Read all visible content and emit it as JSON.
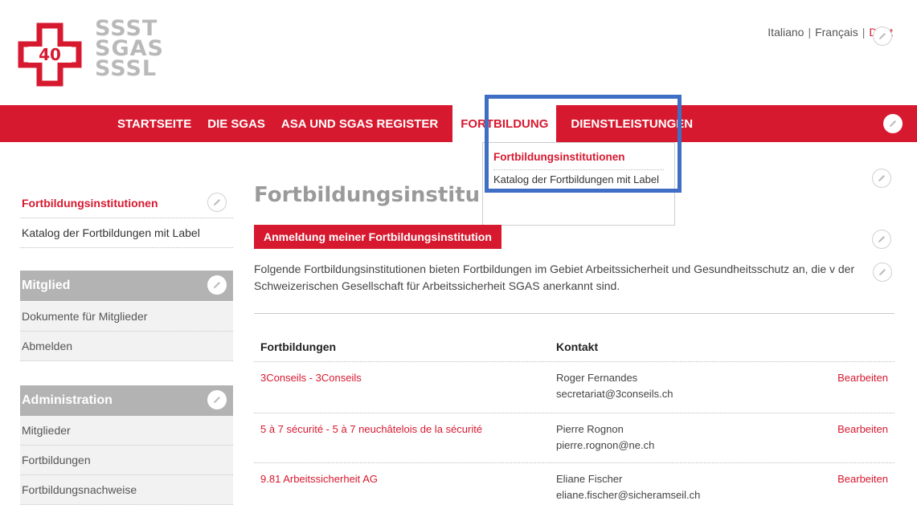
{
  "brand": {
    "logo_number": "40",
    "logo_lines": [
      "SSST",
      "SGAS",
      "SSSL"
    ],
    "accent": "#d7192f",
    "highlight": "#3f6fc4"
  },
  "languages": [
    {
      "label": "Italiano",
      "active": false
    },
    {
      "label": "Français",
      "active": false
    },
    {
      "label": "Deut",
      "active": true
    }
  ],
  "nav": {
    "items": [
      "STARTSEITE",
      "DIE SGAS",
      "ASA UND SGAS REGISTER",
      "FORTBILDUNG",
      "DIENSTLEISTUNGEN"
    ],
    "active": "FORTBILDUNG"
  },
  "dropdown": {
    "item1": "Fortbildungsinstitutionen",
    "item2": "Katalog der Fortbildungen mit Label"
  },
  "sidebar": {
    "links": [
      "Fortbildungsinstitutionen",
      "Katalog der Fortbildungen mit Label"
    ],
    "member_header": "Mitglied",
    "member_items": [
      "Dokumente für Mitglieder",
      "Abmelden"
    ],
    "admin_header": "Administration",
    "admin_items": [
      "Mitglieder",
      "Fortbildungen",
      "Fortbildungsnachweise"
    ]
  },
  "main": {
    "title": "Fortbildungsinstitu",
    "register_button": "Anmeldung meiner Fortbildungsinstitution",
    "description": "Folgende Fortbildungsinstitutionen bieten Fortbildungen im Gebiet Arbeitssicherheit und Gesundheitsschutz an, die v der Schweizerischen Gesellschaft für Arbeitssicherheit SGAS anerkannt sind.",
    "table": {
      "col_training": "Fortbildungen",
      "col_contact": "Kontakt",
      "rows": [
        {
          "name": "3Conseils - 3Conseils",
          "contact_name": "Roger Fernandes",
          "contact_email": "secretariat@3conseils.ch",
          "action": "Bearbeiten"
        },
        {
          "name": "5 à 7 sécurité - 5 à 7 neuchâtelois de la sécurité",
          "contact_name": "Pierre Rognon",
          "contact_email": "pierre.rognon@ne.ch",
          "action": "Bearbeiten"
        },
        {
          "name": "9.81 Arbeitssicherheit AG",
          "contact_name": "Eliane Fischer",
          "contact_email": "eliane.fischer@sicheramseil.ch",
          "action": "Bearbeiten"
        }
      ]
    }
  }
}
